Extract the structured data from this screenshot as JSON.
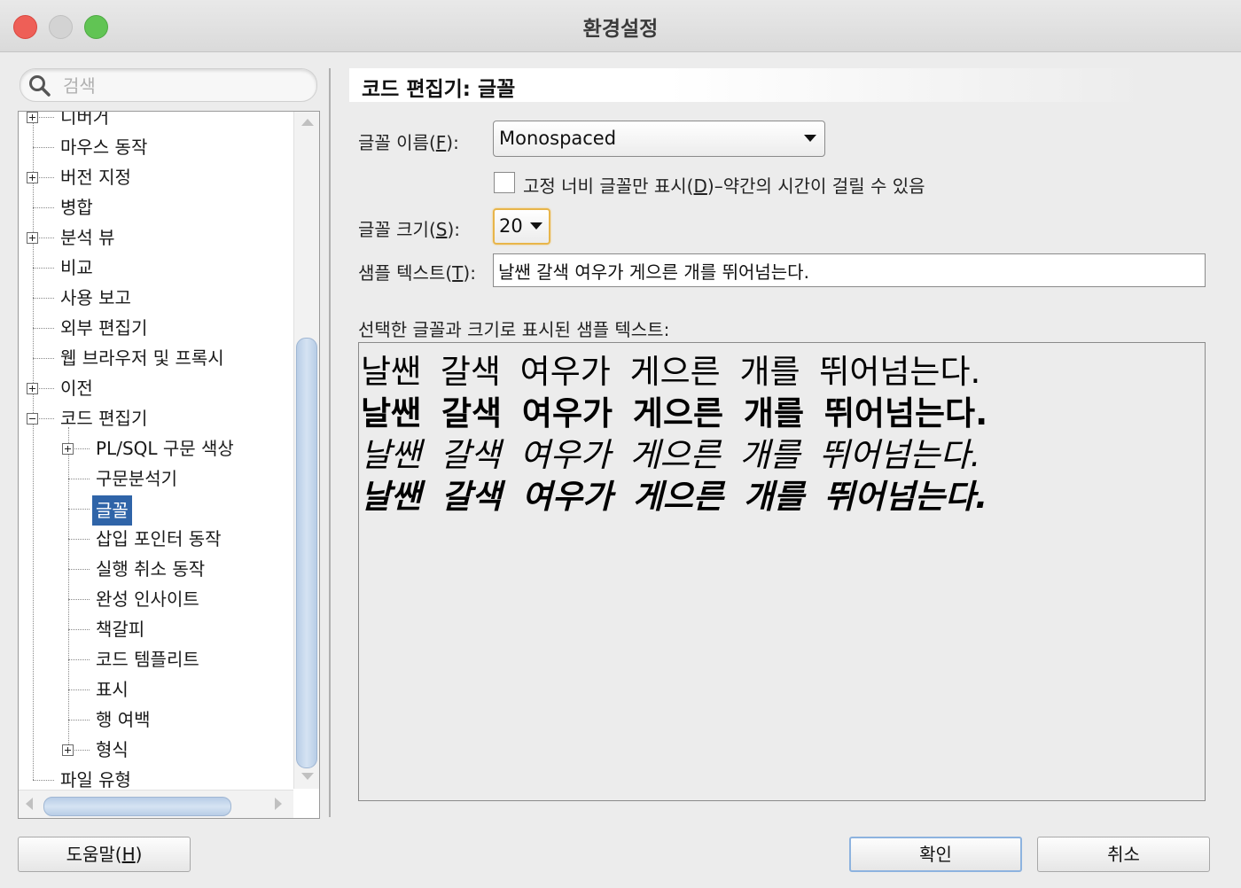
{
  "window": {
    "title": "환경설정"
  },
  "search": {
    "placeholder": "검색"
  },
  "tree": {
    "items": [
      {
        "label": "디버거",
        "level": 0,
        "expander": "plus"
      },
      {
        "label": "마우스 동작",
        "level": 0,
        "expander": "none"
      },
      {
        "label": "버전 지정",
        "level": 0,
        "expander": "plus"
      },
      {
        "label": "병합",
        "level": 0,
        "expander": "none"
      },
      {
        "label": "분석 뷰",
        "level": 0,
        "expander": "plus"
      },
      {
        "label": "비교",
        "level": 0,
        "expander": "none"
      },
      {
        "label": "사용 보고",
        "level": 0,
        "expander": "none"
      },
      {
        "label": "외부 편집기",
        "level": 0,
        "expander": "none"
      },
      {
        "label": "웹 브라우저 및 프록시",
        "level": 0,
        "expander": "none"
      },
      {
        "label": "이전",
        "level": 0,
        "expander": "plus"
      },
      {
        "label": "코드 편집기",
        "level": 0,
        "expander": "minus"
      },
      {
        "label": "PL/SQL 구문 색상",
        "level": 1,
        "expander": "plus"
      },
      {
        "label": "구문분석기",
        "level": 1,
        "expander": "none"
      },
      {
        "label": "글꼴",
        "level": 1,
        "expander": "none",
        "selected": true
      },
      {
        "label": "삽입 포인터 동작",
        "level": 1,
        "expander": "none"
      },
      {
        "label": "실행 취소 동작",
        "level": 1,
        "expander": "none"
      },
      {
        "label": "완성 인사이트",
        "level": 1,
        "expander": "none"
      },
      {
        "label": "책갈피",
        "level": 1,
        "expander": "none"
      },
      {
        "label": "코드 템플리트",
        "level": 1,
        "expander": "none"
      },
      {
        "label": "표시",
        "level": 1,
        "expander": "none"
      },
      {
        "label": "행 여백",
        "level": 1,
        "expander": "none"
      },
      {
        "label": "형식",
        "level": 1,
        "expander": "plus"
      },
      {
        "label": "파일 유형",
        "level": 0,
        "expander": "none"
      }
    ]
  },
  "panel": {
    "title": "코드 편집기: 글꼴",
    "font_name": {
      "label_pre": "글꼴 이름(",
      "mnemonic": "F",
      "label_post": "):",
      "value": "Monospaced"
    },
    "fixed_width": {
      "label_pre": "고정 너비 글꼴만 표시(",
      "mnemonic": "D",
      "label_post": ")–약간의 시간이 걸릴 수 있음",
      "checked": false
    },
    "font_size": {
      "label_pre": "글꼴 크기(",
      "mnemonic": "S",
      "label_post": "):",
      "value": "20"
    },
    "sample_text": {
      "label_pre": "샘플 텍스트(",
      "mnemonic": "T",
      "label_post": "):",
      "value": "날쌘 갈색 여우가 게으른 개를 뛰어넘는다."
    },
    "preview": {
      "label": "선택한 글꼴과 크기로 표시된 샘플 텍스트:",
      "lines": [
        "날쌘 갈색 여우가 게으른 개를 뛰어넘는다.",
        "날쌘 갈색 여우가 게으른 개를 뛰어넘는다.",
        "날쌘 갈색 여우가 게으른 개를 뛰어넘는다.",
        "날쌘 갈색 여우가 게으른 개를 뛰어넘는다."
      ],
      "styles": [
        "regular",
        "bold",
        "italic",
        "bold-italic"
      ]
    }
  },
  "buttons": {
    "help": {
      "label_pre": "도움말(",
      "mnemonic": "H",
      "label_post": ")"
    },
    "ok": "확인",
    "cancel": "취소"
  }
}
